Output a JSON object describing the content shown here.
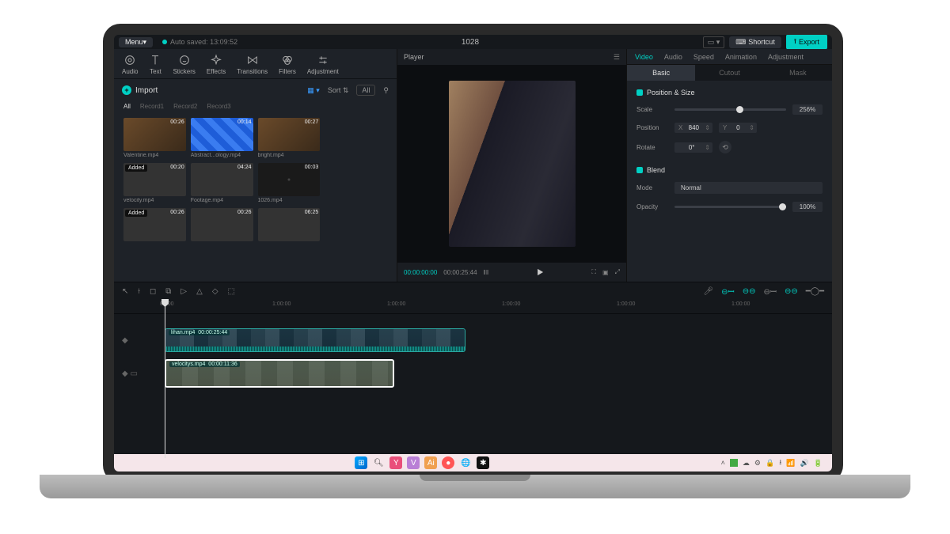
{
  "titlebar": {
    "menu": "Menu",
    "autosave": "Auto saved: 13:09:52",
    "project": "1028",
    "shortcut": "Shortcut",
    "export": "Export"
  },
  "tools": {
    "audio": "Audio",
    "text": "Text",
    "stickers": "Stickers",
    "effects": "Effects",
    "transitions": "Transitions",
    "filters": "Filters",
    "adjustment": "Adjustment"
  },
  "import": {
    "label": "Import",
    "sort": "Sort",
    "all": "All"
  },
  "lib_tabs": {
    "all": "All",
    "r1": "Record1",
    "r2": "Record2",
    "r3": "Record3"
  },
  "media": [
    {
      "name": "Valentine.mp4",
      "time": "00:26",
      "badge": ""
    },
    {
      "name": "Abstract...ology.mp4",
      "time": "00:14",
      "badge": ""
    },
    {
      "name": "bright.mp4",
      "time": "00:27",
      "badge": ""
    },
    {
      "name": "velocity.mp4",
      "time": "00:20",
      "badge": "Added"
    },
    {
      "name": "Footage.mp4",
      "time": "04:24",
      "badge": ""
    },
    {
      "name": "1026.mp4",
      "time": "00:03",
      "badge": ""
    },
    {
      "name": "",
      "time": "00:26",
      "badge": "Added"
    },
    {
      "name": "",
      "time": "00:26",
      "badge": ""
    },
    {
      "name": "",
      "time": "06:25",
      "badge": ""
    }
  ],
  "player": {
    "title": "Player",
    "cur": "00:00:00:00",
    "dur": "00:00:25:44"
  },
  "props": {
    "tabs": {
      "video": "Video",
      "audio": "Audio",
      "speed": "Speed",
      "animation": "Animation",
      "adjustment": "Adjustment"
    },
    "subtabs": {
      "basic": "Basic",
      "cutout": "Cutout",
      "mask": "Mask"
    },
    "pos_size": "Position & Size",
    "scale": "Scale",
    "scale_val": "256%",
    "position": "Position",
    "pos_x_label": "X",
    "pos_x": "840",
    "pos_y_label": "Y",
    "pos_y": "0",
    "rotate": "Rotate",
    "rotate_val": "0°",
    "blend": "Blend",
    "mode": "Mode",
    "mode_val": "Normal",
    "opacity": "Opacity",
    "opacity_val": "100%"
  },
  "ruler": [
    "00:00",
    "1:00:00",
    "1:00:00",
    "1:00:00",
    "1:00:00",
    "1:00:00"
  ],
  "clips": {
    "c1": {
      "name": "lihan.mp4",
      "dur": "00:00:25:44"
    },
    "c2": {
      "name": "velocitys.mp4",
      "dur": "00:00:11:36"
    }
  }
}
